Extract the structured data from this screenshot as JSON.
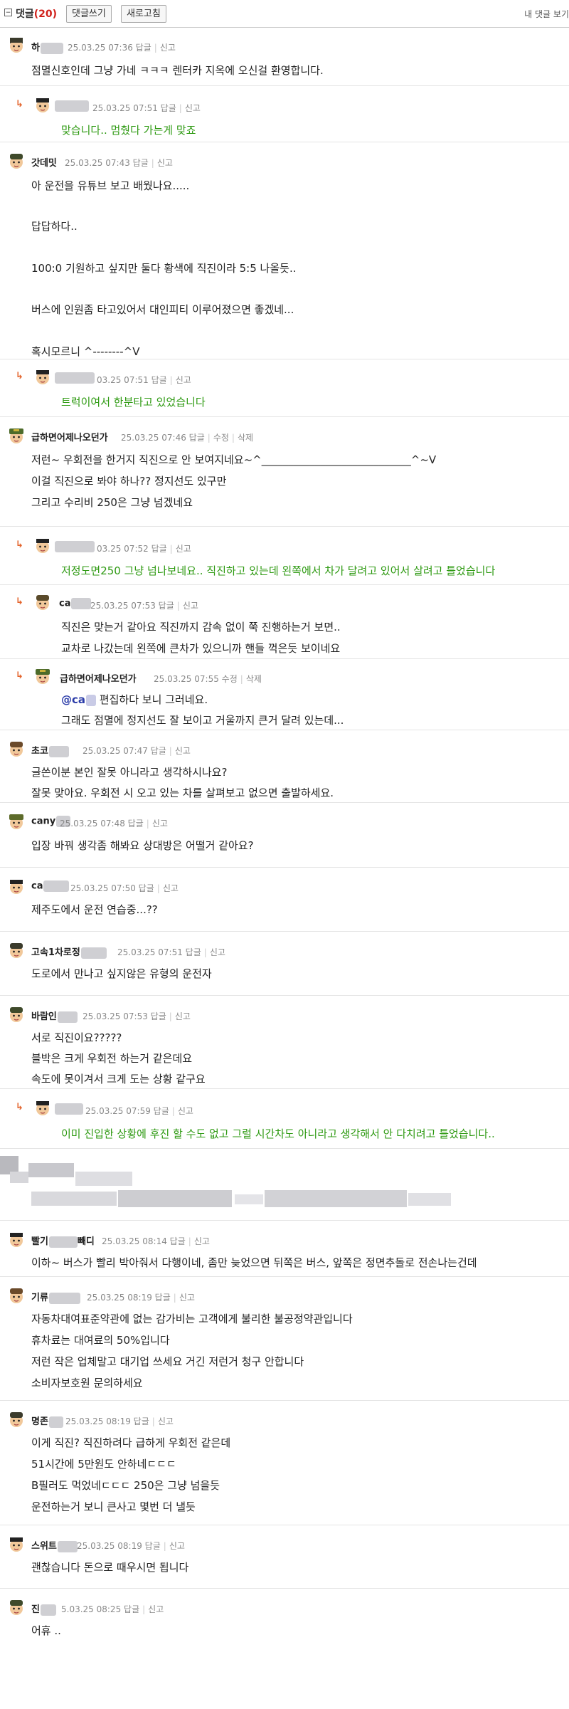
{
  "header": {
    "toggle_icon": "minus-box-icon",
    "title": "댓글",
    "count": "(20)",
    "write_label": "댓글쓰기",
    "refresh_label": "새로고침",
    "my_comments_label": "내 댓글 보기"
  },
  "comments": [
    {
      "name": "하",
      "meta": "25.03.25 07:36",
      "reply": "답글",
      "report": "신고",
      "lines": [
        "점멸신호인데 그냥 가네 ㅋㅋㅋ 렌터카 지옥에 오신걸 환영합니다."
      ]
    },
    {
      "name": "",
      "meta": "25.03.25 07:51",
      "reply": "답글",
      "report": "신고",
      "lines": [
        "맞습니다.. 멈췄다 가는게 맞죠"
      ]
    },
    {
      "name": "갓데밋",
      "meta": "25.03.25 07:43",
      "reply": "답글",
      "report": "신고",
      "lines": [
        "아 운전을 유튜브 보고 배웠나요.....",
        "답답하다..",
        "100:0 기원하고 싶지만 둘다 황색에 직진이라 5:5 나올듯..",
        "버스에 인원좀 타고있어서 대인피티 이루어졌으면 좋겠네...",
        "혹시모르니 ^--------^V"
      ]
    },
    {
      "name": "",
      "meta": "03.25 07:51",
      "reply": "답글",
      "report": "신고",
      "lines": [
        "트럭이여서 한분타고 있었습니다"
      ]
    },
    {
      "name": "급하면어제나오던가",
      "meta": "25.03.25 07:46",
      "reply": "답글",
      "edit": "수정",
      "delete": "삭제",
      "lines": [
        "저런~ 우회전을 한거지 직진으로 안 보여지네요~^____________________________^~V",
        "이걸 직진으로 봐야 하나?? 정지선도 있구만",
        "그리고 수리비 250은 그냥 넘겠네요"
      ]
    },
    {
      "name": "",
      "meta": "03.25 07:52",
      "reply": "답글",
      "report": "신고",
      "lines": [
        "저정도면250 그냥 넘나보네요.. 직진하고 있는데 왼쪽에서 차가 달려고 있어서 살려고 틀었습니다"
      ]
    },
    {
      "name": "ca",
      "meta": "25.03.25 07:53",
      "reply": "답글",
      "report": "신고",
      "lines": [
        "직진은 맞는거 같아요 직진까지 감속 없이 쭉 진행하는거 보면..",
        "교차로 나갔는데 왼쪽에 큰차가 있으니까 핸들 꺽은듯 보이네요"
      ]
    },
    {
      "name": "급하면어제나오던가",
      "meta": "25.03.25 07:55",
      "edit": "수정",
      "delete": "삭제",
      "mention": "@ca",
      "lines": [
        "편집하다 보니 그러네요.",
        "그래도 점멸에 정지선도 잘 보이고 거울까지 큰거 달려 있는데..."
      ]
    },
    {
      "name": "초코",
      "meta": "25.03.25 07:47",
      "reply": "답글",
      "report": "신고",
      "lines": [
        "글쓴이분 본인 잘못 아니라고 생각하시나요?",
        "잘못 맞아요. 우회전 시 오고 있는 차를 살펴보고 없으면 출발하세요."
      ]
    },
    {
      "name": "cany",
      "meta": "25.03.25 07:48",
      "reply": "답글",
      "report": "신고",
      "lines": [
        "입장 바꿔 생각좀 해봐요 상대방은 어떨거 같아요?"
      ]
    },
    {
      "name": "ca",
      "meta": "25.03.25 07:50",
      "reply": "답글",
      "report": "신고",
      "lines": [
        "제주도에서 운전 연습중...??"
      ]
    },
    {
      "name": "고속1차로정",
      "meta": "25.03.25 07:51",
      "reply": "답글",
      "report": "신고",
      "lines": [
        "도로에서 만나고 싶지않은 유형의 운전자"
      ]
    },
    {
      "name": "바람인",
      "meta": "25.03.25 07:53",
      "reply": "답글",
      "report": "신고",
      "lines": [
        "서로 직진이요?????",
        "블박은 크게 우회전 하는거 같은데요",
        "속도에 못이겨서 크게 도는 상황 같구요"
      ]
    },
    {
      "name": "",
      "meta": "25.03.25 07:59",
      "reply": "답글",
      "report": "신고",
      "lines": [
        "이미 진입한 상황에 후진 할 수도 없고 그럴 시간차도 아니라고 생각해서 안 다치려고 틀었습니다.."
      ]
    },
    {
      "name": "빨기",
      "name_end": "빼디",
      "meta": "25.03.25 08:14",
      "reply": "답글",
      "report": "신고",
      "lines": [
        "이하~ 버스가 빨리 박아줘서 다행이네, 좀만 늦었으면 뒤쪽은 버스, 앞쪽은 정면추돌로 전손나는건데"
      ]
    },
    {
      "name": "기류",
      "meta": "25.03.25 08:19",
      "reply": "답글",
      "report": "신고",
      "lines": [
        "자동차대여표준약관에 없는 감가비는 고객에게 불리한 불공정약관입니다",
        "휴차료는 대여료의 50%입니다",
        "저런 작은 업체말고 대기업 쓰세요 거긴 저런거 청구 안합니다",
        "소비자보호원 문의하세요"
      ]
    },
    {
      "name": "명존",
      "meta": "25.03.25 08:19",
      "reply": "답글",
      "report": "신고",
      "lines": [
        "이게 직진? 직진하려다 급하게 우회전 같은데",
        "51시간에 5만원도 안하네ㄷㄷㄷ",
        "B필러도 먹었네ㄷㄷㄷ 250은 그냥 넘을듯",
        "운전하는거 보니 큰사고 몇번 더 낼듯"
      ]
    },
    {
      "name": "스위트",
      "meta": "25.03.25 08:19",
      "reply": "답글",
      "report": "신고",
      "lines": [
        "괜찮습니다 돈으로 때우시면 됩니다"
      ]
    },
    {
      "name": "진",
      "meta": "5.03.25 08:25",
      "reply": "답글",
      "report": "신고",
      "lines": [
        "어휴 .."
      ]
    }
  ]
}
